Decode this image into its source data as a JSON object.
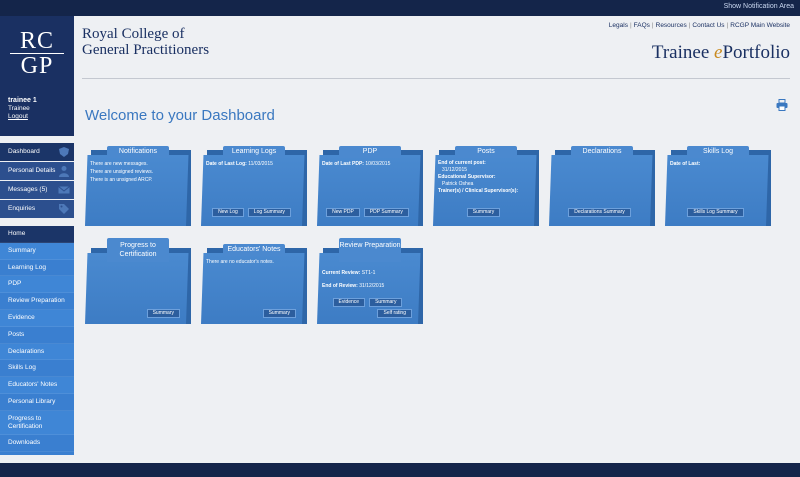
{
  "topbar": {
    "notification_area": "Show Notification Area"
  },
  "logo": {
    "line1": "RC",
    "line2": "GP"
  },
  "college": {
    "line1": "Royal College of",
    "line2": "General Practitioners"
  },
  "user": {
    "name": "trainee 1",
    "role": "Trainee",
    "logout": "Logout"
  },
  "top_links": [
    "Legals",
    "FAQs",
    "Resources",
    "Contact Us",
    "RCGP Main Website"
  ],
  "brand": {
    "pre": "Trainee ",
    "e": "e",
    "post": "Portfolio"
  },
  "page_title": "Welcome to your Dashboard",
  "nav_top": [
    {
      "label": "Dashboard",
      "icon": "shield-icon"
    },
    {
      "label": "Personal Details",
      "icon": "person-icon"
    },
    {
      "label": "Messages (5)",
      "icon": "envelope-icon"
    },
    {
      "label": "Enquiries",
      "icon": "tag-icon"
    }
  ],
  "nav_main": [
    "Home",
    "Summary",
    "Learning Log",
    "PDP",
    "Review Preparation",
    "Evidence",
    "Posts",
    "Declarations",
    "Skills Log",
    "Educators' Notes",
    "Personal Library",
    "Progress to Certification",
    "Downloads"
  ],
  "cards": {
    "notifications": {
      "title": "Notifications",
      "lines": [
        "There are new messages.",
        "There are unsigned reviews.",
        "There is an unsigned ARCP."
      ]
    },
    "learning_logs": {
      "title": "Learning Logs",
      "label": "Date of Last Log:",
      "value": "11/03/2015",
      "btn1": "New Log",
      "btn2": "Log Summary"
    },
    "pdp": {
      "title": "PDP",
      "label": "Date of Last PDP:",
      "value": "10/03/2015",
      "btn1": "New PDP",
      "btn2": "PDP Summary"
    },
    "posts": {
      "title": "Posts",
      "end_label": "End of current post:",
      "end_value": "31/12/2015",
      "sup_label": "Educational Supervisor:",
      "sup_value": "Patrick Oshea",
      "trainer_label": "Trainer(s) / Clinical Supervisor(s):",
      "btn": "Summary"
    },
    "declarations": {
      "title": "Declarations",
      "btn": "Declarations Summary"
    },
    "skills_log": {
      "title": "Skills Log",
      "label": "Date of Last:",
      "btn": "Skills Log Summary"
    },
    "progress": {
      "title": "Progress to Certification",
      "btn": "Summary"
    },
    "educators_notes": {
      "title": "Educators' Notes",
      "line": "There are no educator's notes.",
      "btn": "Summary"
    },
    "review_prep": {
      "title": "Review Preparation",
      "cur_label": "Current Review:",
      "cur_value": "ST1-1",
      "end_label": "End of Review:",
      "end_value": "31/12/2015",
      "btn1": "Evidence",
      "btn2": "Summary",
      "btn3": "Self rating"
    }
  },
  "colors": {
    "navy": "#1a3062",
    "accent_blue": "#3a78c0",
    "card_blue": "#4a8ad0",
    "gold": "#c98a1f"
  }
}
